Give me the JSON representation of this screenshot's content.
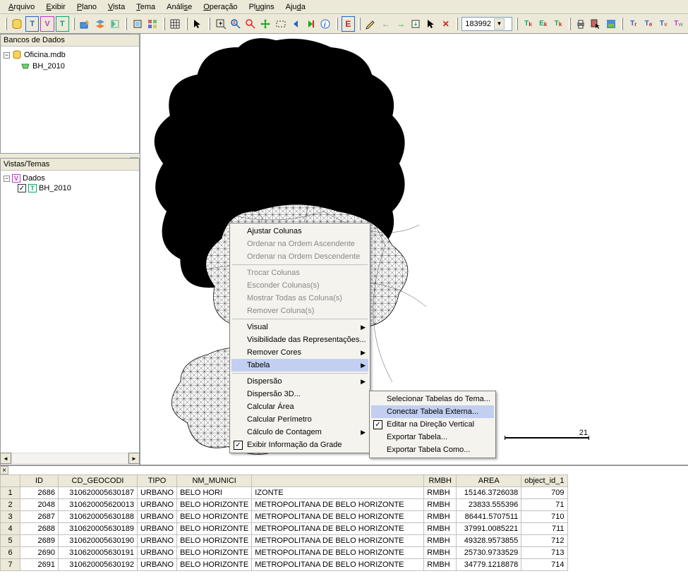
{
  "menubar": [
    "Arquivo",
    "Exibir",
    "Plano",
    "Vista",
    "Tema",
    "Análise",
    "Operação",
    "Plugins",
    "Ajuda"
  ],
  "toolbar": {
    "scale_value": "183992"
  },
  "panels": {
    "databases": {
      "title": "Bancos de Dados",
      "root": "Oficina.mdb",
      "child": "BH_2010"
    },
    "views": {
      "title": "Vistas/Temas",
      "root": "Dados",
      "child": "BH_2010"
    }
  },
  "scale_label": "21",
  "context1": [
    {
      "label": "Ajustar Colunas",
      "enabled": true
    },
    {
      "label": "Ordenar na Ordem Ascendente",
      "enabled": false
    },
    {
      "label": "Ordenar na Ordem Descendente",
      "enabled": false
    },
    {
      "sep": true
    },
    {
      "label": "Trocar Colunas",
      "enabled": false
    },
    {
      "label": "Esconder Colunas(s)",
      "enabled": false
    },
    {
      "label": "Mostrar Todas as Coluna(s)",
      "enabled": false
    },
    {
      "label": "Remover Coluna(s)",
      "enabled": false
    },
    {
      "sep": true
    },
    {
      "label": "Visual",
      "enabled": true,
      "sub": true
    },
    {
      "label": "Visibilidade das Representações...",
      "enabled": true
    },
    {
      "label": "Remover Cores",
      "enabled": true,
      "sub": true
    },
    {
      "label": "Tabela",
      "enabled": true,
      "sub": true,
      "hl": true
    },
    {
      "sep": true
    },
    {
      "label": "Dispersão",
      "enabled": true,
      "sub": true
    },
    {
      "label": "Dispersão 3D...",
      "enabled": true
    },
    {
      "label": "Calcular Área",
      "enabled": true
    },
    {
      "label": "Calcular Perímetro",
      "enabled": true
    },
    {
      "label": "Cálculo de Contagem",
      "enabled": true,
      "sub": true
    },
    {
      "label": "Exibir Informação da Grade",
      "enabled": true,
      "chk": true
    }
  ],
  "context2": [
    {
      "label": "Selecionar Tabelas do Tema...",
      "enabled": true
    },
    {
      "label": "Conectar Tabela Externa...",
      "enabled": true,
      "hl": true
    },
    {
      "label": "Editar na Direção Vertical",
      "enabled": true,
      "chk": true
    },
    {
      "label": "Exportar Tabela...",
      "enabled": true
    },
    {
      "label": "Exportar Tabela Como...",
      "enabled": true
    }
  ],
  "grid": {
    "headers": [
      "",
      "ID",
      "CD_GEOCODI",
      "TIPO",
      "NM_MUNICI",
      "",
      "RMBH",
      "AREA",
      "object_id_1"
    ],
    "header_partial_meso": "",
    "rows": [
      {
        "n": 1,
        "id": 2686,
        "geo": "310620005630187",
        "tipo": "URBANO",
        "nm": "BELO HORI",
        "meso": "IZONTE",
        "rmbh": "RMBH",
        "area": "15146.3726038",
        "obj": 709
      },
      {
        "n": 2,
        "id": 2048,
        "geo": "310620005620013",
        "tipo": "URBANO",
        "nm": "BELO HORIZONTE",
        "meso": "METROPOLITANA DE BELO HORIZONTE",
        "rmbh": "RMBH",
        "area": "23833.555396",
        "obj": 71
      },
      {
        "n": 3,
        "id": 2687,
        "geo": "310620005630188",
        "tipo": "URBANO",
        "nm": "BELO HORIZONTE",
        "meso": "METROPOLITANA DE BELO HORIZONTE",
        "rmbh": "RMBH",
        "area": "86441.5707511",
        "obj": 710
      },
      {
        "n": 4,
        "id": 2688,
        "geo": "310620005630189",
        "tipo": "URBANO",
        "nm": "BELO HORIZONTE",
        "meso": "METROPOLITANA DE BELO HORIZONTE",
        "rmbh": "RMBH",
        "area": "37991.0085221",
        "obj": 711
      },
      {
        "n": 5,
        "id": 2689,
        "geo": "310620005630190",
        "tipo": "URBANO",
        "nm": "BELO HORIZONTE",
        "meso": "METROPOLITANA DE BELO HORIZONTE",
        "rmbh": "RMBH",
        "area": "49328.9573855",
        "obj": 712
      },
      {
        "n": 6,
        "id": 2690,
        "geo": "310620005630191",
        "tipo": "URBANO",
        "nm": "BELO HORIZONTE",
        "meso": "METROPOLITANA DE BELO HORIZONTE",
        "rmbh": "RMBH",
        "area": "25730.9733529",
        "obj": 713
      },
      {
        "n": 7,
        "id": 2691,
        "geo": "310620005630192",
        "tipo": "URBANO",
        "nm": "BELO HORIZONTE",
        "meso": "METROPOLITANA DE BELO HORIZONTE",
        "rmbh": "RMBH",
        "area": "34779.1218878",
        "obj": 714
      }
    ]
  }
}
